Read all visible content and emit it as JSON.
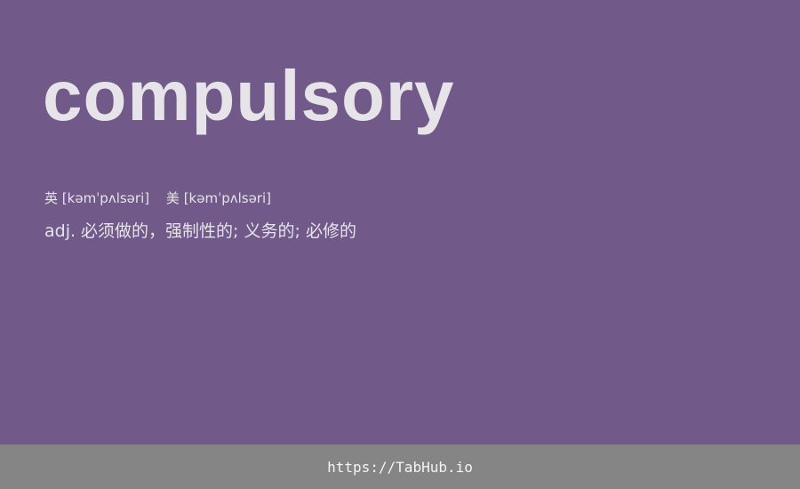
{
  "word": "compulsory",
  "phonetics": {
    "uk_label": "英",
    "uk_ipa": "[kəmˈpʌlsəri]",
    "us_label": "美",
    "us_ipa": "[kəmˈpʌlsəri]"
  },
  "definition": "adj. 必须做的，强制性的; 义务的; 必修的",
  "footer": {
    "url": "https://TabHub.io"
  },
  "colors": {
    "background": "#715989",
    "footer_background": "#858585",
    "text": "#e6e4e8"
  }
}
